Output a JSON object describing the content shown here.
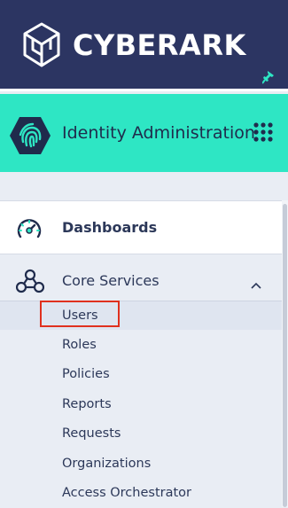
{
  "brand": {
    "part1": "CYBER",
    "part2": "ARK",
    "logo_icon": "cube-logo-icon",
    "pin_icon": "pin-icon"
  },
  "app": {
    "title": "Identity Administration",
    "icon": "fingerprint-hexagon-icon",
    "switcher_icon": "app-grid-icon"
  },
  "colors": {
    "header_bg": "#2c3562",
    "app_bar_bg": "#2ee6c4",
    "selection_outline": "#e0301e",
    "pin": "#2ee6c4"
  },
  "nav": {
    "dashboards": {
      "label": "Dashboards",
      "icon": "speedometer-icon"
    },
    "core_services": {
      "label": "Core Services",
      "icon": "network-nodes-icon",
      "expanded": true,
      "items": [
        "Users",
        "Roles",
        "Policies",
        "Reports",
        "Requests",
        "Organizations",
        "Access Orchestrator"
      ],
      "selected": "Users"
    }
  }
}
